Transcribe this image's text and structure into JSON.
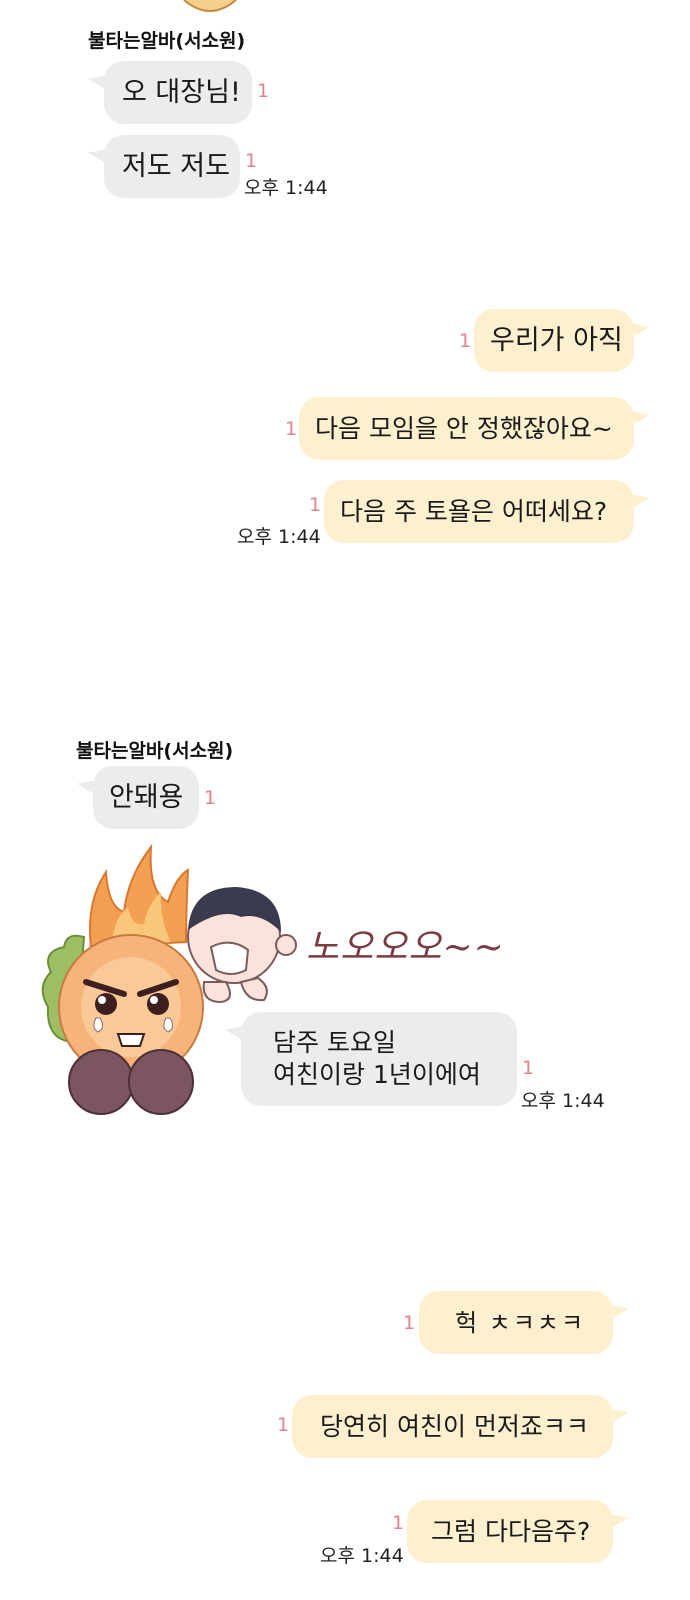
{
  "sender_name": "불타는알바(서소원)",
  "unread_count": "1",
  "timestamp": "오후 1:44",
  "group1": {
    "messages": [
      "오 대장님!",
      "저도 저도"
    ]
  },
  "group2": {
    "messages": [
      "우리가 아직",
      "다음 모임을 안 정했잖아요~",
      "다음 주 토욜은 어떠세요?"
    ]
  },
  "group3": {
    "messages": [
      "안돼용"
    ],
    "sticker_text": "노오오오~~",
    "reply_lines": [
      "담주 토요일",
      "여친이랑 1년이에여"
    ]
  },
  "group4": {
    "messages": [
      "헉 ㅊㅋㅊㅋ",
      "당연히 여친이 먼저죠ㅋㅋ",
      "그럼 다다음주?"
    ]
  },
  "colors": {
    "incoming_bubble": "#ececec",
    "outgoing_bubble": "#fdf0cf",
    "unread": "#e2848a"
  }
}
